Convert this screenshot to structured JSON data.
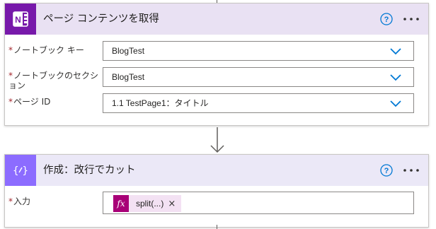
{
  "step1": {
    "title": "ページ コンテンツを取得",
    "icon": "onenote-icon",
    "icon_letter": "N",
    "fields": [
      {
        "required_mark": "*",
        "label": "ノートブック キー",
        "value": "BlogTest"
      },
      {
        "required_mark": "*",
        "label": "ノートブックのセクション",
        "value": "BlogTest"
      },
      {
        "required_mark": "*",
        "label": "ページ ID",
        "value": "1.1 TestPage1：タイトル"
      }
    ]
  },
  "step2": {
    "title": "作成：改行でカット",
    "icon": "compose-icon",
    "icon_glyph": "{ ⁄ }",
    "field": {
      "required_mark": "*",
      "label": "入力",
      "token_glyph": "fx",
      "token_label": "split(...)",
      "token_close": "×"
    }
  },
  "colors": {
    "onenote_purple": "#7719aa",
    "compose_purple": "#8c6cff",
    "header1_bg": "#e9e1f3",
    "header2_bg": "#ebe8f7",
    "accent_blue": "#0078d4",
    "token_magenta": "#a80077",
    "required_red": "#a4262c"
  }
}
